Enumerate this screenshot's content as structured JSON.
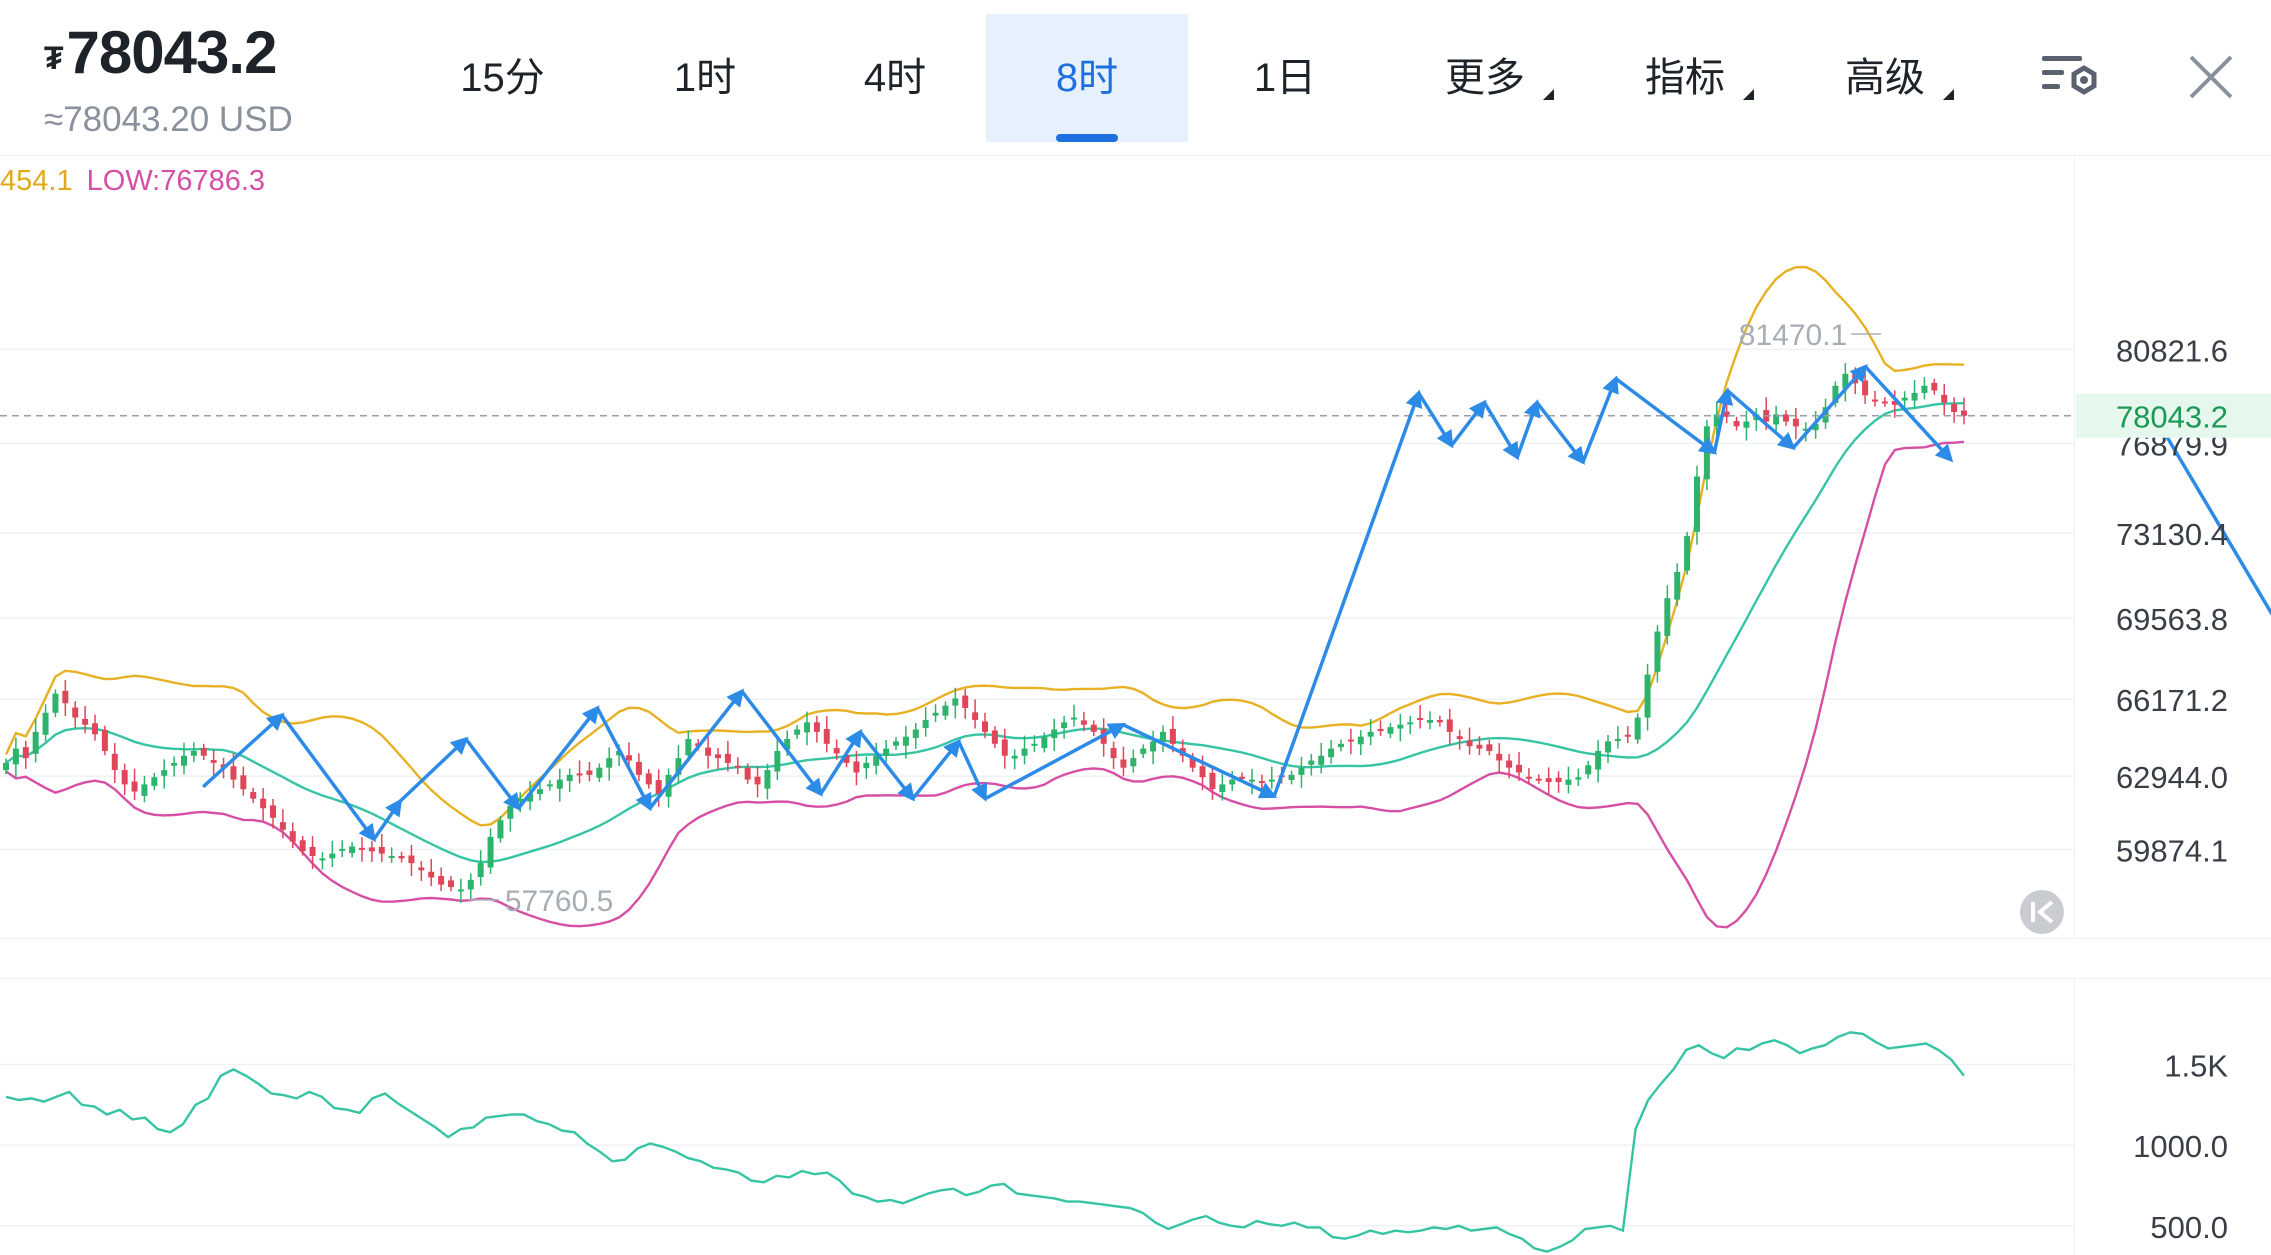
{
  "header": {
    "currency_symbol": "₮",
    "price": "78043.2",
    "price_usd": "≈78043.20 USD"
  },
  "tabs": [
    {
      "label": "15分",
      "active": false
    },
    {
      "label": "1时",
      "active": false
    },
    {
      "label": "4时",
      "active": false
    },
    {
      "label": "8时",
      "active": true
    },
    {
      "label": "1日",
      "active": false
    },
    {
      "label": "更多",
      "dropdown": true
    },
    {
      "label": "指标",
      "dropdown": true
    },
    {
      "label": "高级",
      "dropdown": true
    }
  ],
  "icons": {
    "settings": "chart-settings-icon",
    "close": "close-icon",
    "scroll_latest": "scroll-to-latest-icon"
  },
  "legend": {
    "high_text": "454.1",
    "low_text": "LOW:76786.3"
  },
  "colors": {
    "up": "#2db36b",
    "down": "#e0465a",
    "boll_upper": "#e8b123",
    "boll_mid": "#36c4a5",
    "boll_lower": "#d64fa4",
    "annotation": "#2d8be8",
    "accent": "#1e6fe0",
    "last_price_bg": "#e6f7ed"
  },
  "chart_data": [
    {
      "type": "candlestick",
      "y_ticks": [
        "80821.6",
        "76879.9",
        "73130.4",
        "69563.8",
        "66171.2",
        "62944.0",
        "59874.1"
      ],
      "y_tick_values": [
        80821.6,
        76879.9,
        73130.4,
        69563.8,
        66171.2,
        62944.0,
        59874.1
      ],
      "ylim": [
        56500,
        87500
      ],
      "last_price": {
        "label": "78043.2",
        "value": 78043.2
      },
      "max_marker": {
        "label": "81470.1",
        "value": 81470.1
      },
      "min_marker": {
        "label": "57760.5",
        "value": 57760.5
      },
      "candle_count": 200,
      "closes": [
        63500,
        64100,
        63700,
        64800,
        65600,
        66400,
        66000,
        65400,
        65100,
        64700,
        64000,
        63200,
        62600,
        62300,
        62600,
        62900,
        63200,
        63500,
        63800,
        64000,
        63800,
        63500,
        63300,
        62800,
        62400,
        62000,
        61600,
        61200,
        60700,
        60200,
        59800,
        59600,
        59500,
        59700,
        59900,
        60000,
        59900,
        59800,
        59700,
        59600,
        59500,
        59300,
        59000,
        58700,
        58400,
        58300,
        58200,
        58600,
        59300,
        60400,
        61100,
        61700,
        62000,
        62200,
        62400,
        62600,
        62800,
        63000,
        63000,
        63000,
        63300,
        63700,
        64000,
        63600,
        63000,
        62600,
        62200,
        63000,
        63700,
        64500,
        64200,
        63800,
        63700,
        63500,
        63300,
        62800,
        62600,
        63200,
        64000,
        64500,
        64900,
        65200,
        64800,
        64300,
        63900,
        63500,
        63100,
        63500,
        63800,
        64100,
        64400,
        64600,
        64900,
        65300,
        65600,
        65900,
        66200,
        65800,
        65300,
        64800,
        64300,
        63800,
        63800,
        64100,
        64300,
        64600,
        64900,
        65200,
        65400,
        65100,
        64800,
        64300,
        63700,
        63300,
        63700,
        64100,
        64400,
        64800,
        64300,
        63800,
        63300,
        62900,
        62400,
        62600,
        62800,
        62900,
        62800,
        62700,
        62800,
        62900,
        63000,
        63300,
        63600,
        63800,
        64100,
        64300,
        64400,
        64600,
        64800,
        64900,
        65000,
        65100,
        65200,
        65300,
        65300,
        65200,
        64800,
        64500,
        64200,
        64100,
        64000,
        63600,
        63300,
        63100,
        62900,
        62800,
        62700,
        62700,
        62800,
        62900,
        63400,
        64000,
        64400,
        64500,
        64600,
        65400,
        67200,
        69000,
        70400,
        71500,
        73000,
        75500,
        77600,
        78100,
        78000,
        77600,
        77800,
        78100,
        77800,
        78100,
        77800,
        77600,
        77500,
        77700,
        78400,
        79300,
        79800,
        79400,
        78900,
        78700,
        78600,
        78500,
        78800,
        79000,
        79300,
        79100,
        78600,
        78200,
        78043
      ]
    },
    {
      "type": "line",
      "y_ticks": [
        "1.5K",
        "1000.0",
        "500.0"
      ],
      "y_tick_values": [
        1500,
        1000,
        500
      ],
      "ylim": [
        350,
        1900
      ],
      "values": [
        1300,
        1280,
        1290,
        1270,
        1300,
        1330,
        1250,
        1240,
        1190,
        1220,
        1160,
        1170,
        1100,
        1080,
        1130,
        1250,
        1290,
        1430,
        1470,
        1430,
        1380,
        1320,
        1310,
        1290,
        1330,
        1300,
        1230,
        1220,
        1200,
        1290,
        1320,
        1260,
        1210,
        1160,
        1110,
        1050,
        1100,
        1110,
        1170,
        1180,
        1190,
        1190,
        1150,
        1130,
        1090,
        1080,
        1010,
        960,
        900,
        910,
        980,
        1010,
        990,
        960,
        920,
        900,
        860,
        850,
        830,
        780,
        770,
        810,
        800,
        840,
        820,
        830,
        780,
        700,
        680,
        650,
        660,
        640,
        670,
        700,
        720,
        730,
        690,
        710,
        750,
        760,
        700,
        690,
        680,
        670,
        650,
        650,
        640,
        630,
        620,
        610,
        580,
        520,
        480,
        510,
        540,
        560,
        520,
        500,
        490,
        530,
        510,
        500,
        520,
        490,
        490,
        430,
        420,
        440,
        470,
        450,
        470,
        460,
        470,
        490,
        480,
        500,
        470,
        480,
        490,
        450,
        420,
        360,
        340,
        370,
        410,
        480,
        490,
        500,
        470,
        1100,
        1280,
        1380,
        1470,
        1590,
        1620,
        1570,
        1540,
        1600,
        1590,
        1630,
        1650,
        1620,
        1570,
        1600,
        1620,
        1670,
        1700,
        1690,
        1640,
        1600,
        1610,
        1620,
        1630,
        1590,
        1530,
        1430
      ]
    }
  ],
  "annotations": {
    "zigzag": [
      [
        30,
        62500
      ],
      [
        42,
        65500
      ],
      [
        56,
        60300
      ],
      [
        60,
        61900
      ],
      [
        70,
        64500
      ],
      [
        78,
        61600
      ],
      [
        90,
        65800
      ],
      [
        98,
        61600
      ],
      [
        112,
        66500
      ],
      [
        124,
        62200
      ],
      [
        130,
        64800
      ],
      [
        138,
        62000
      ],
      [
        145,
        64400
      ],
      [
        149,
        62000
      ],
      [
        170,
        65100
      ],
      [
        193,
        62100
      ],
      [
        215,
        79000
      ],
      [
        220,
        76800
      ],
      [
        225,
        78600
      ],
      [
        230,
        76300
      ],
      [
        233,
        78600
      ],
      [
        240,
        76100
      ],
      [
        245,
        79600
      ],
      [
        260,
        76500
      ],
      [
        262,
        79100
      ],
      [
        272,
        76700
      ],
      [
        283,
        80100
      ],
      [
        296,
        76200
      ]
    ],
    "projection": [
      [
        326,
        78500
      ],
      [
        374,
        56200
      ]
    ],
    "zigzag_min_index": 0,
    "zigzag_max_index": 374
  }
}
